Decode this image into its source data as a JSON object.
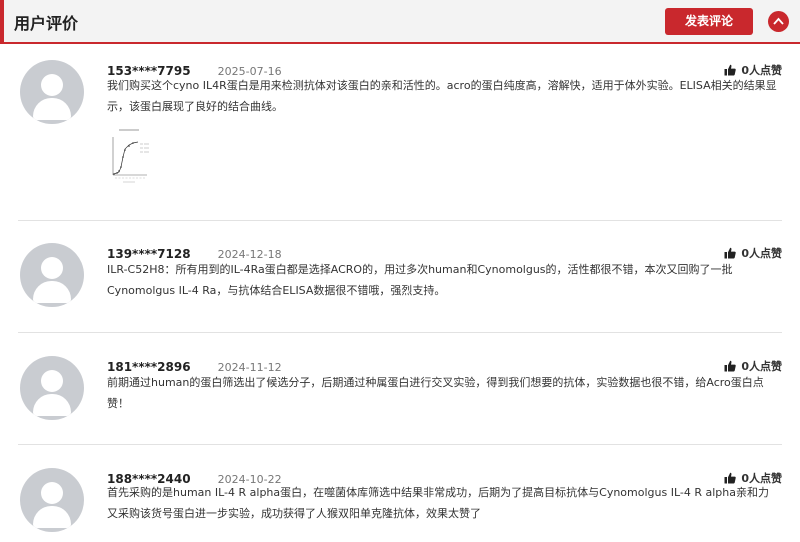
{
  "header": {
    "title": "用户评价",
    "post_button": "发表评论"
  },
  "reviews": [
    {
      "user": "153****7795",
      "date": "2025-07-16",
      "likes": "0人点赞",
      "text": "我们购买这个cyno IL4R蛋白是用来检测抗体对该蛋白的亲和活性的。acro的蛋白纯度高，溶解快，适用于体外实验。ELISA相关的结果显示，该蛋白展现了良好的结合曲线。",
      "has_image": true
    },
    {
      "user": "139****7128",
      "date": "2024-12-18",
      "likes": "0人点赞",
      "text": "ILR-C52H8：所有用到的IL-4Ra蛋白都是选择ACRO的，用过多次human和Cynomolgus的，活性都很不错，本次又回购了一批Cynomolgus IL-4 Ra，与抗体结合ELISA数据很不错哦，强烈支持。"
    },
    {
      "user": "181****2896",
      "date": "2024-11-12",
      "likes": "0人点赞",
      "text": "前期通过human的蛋白筛选出了候选分子，后期通过种属蛋白进行交叉实验，得到我们想要的抗体，实验数据也很不错，给Acro蛋白点赞！"
    },
    {
      "user": "188****2440",
      "date": "2024-10-22",
      "likes": "0人点赞",
      "text": "首先采购的是human IL-4 R alpha蛋白，在噬菌体库筛选中结果非常成功，后期为了提高目标抗体与Cynomolgus IL-4 R alpha亲和力又采购该货号蛋白进一步实验，成功获得了人猴双阳单克隆抗体，效果太赞了"
    }
  ],
  "colors": {
    "accent": "#c9282d",
    "avatar": "#c9ccd1",
    "divider": "#e2e2e2"
  },
  "icons": {
    "collapse": "chevron-up-icon",
    "like": "thumbs-up-icon",
    "avatar": "default-user-icon"
  }
}
